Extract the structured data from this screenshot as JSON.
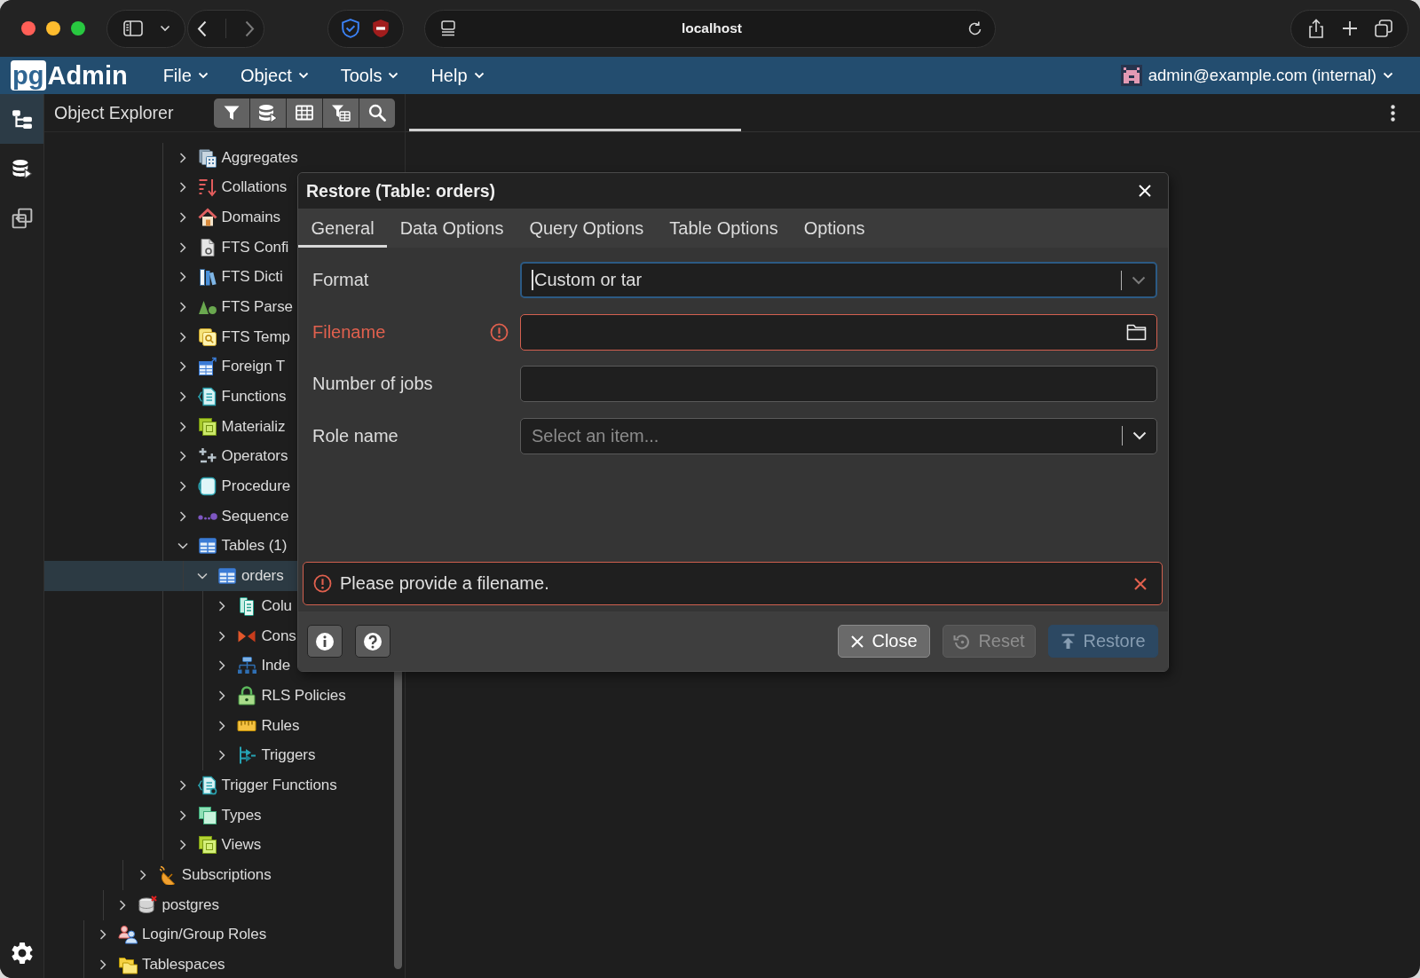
{
  "browser": {
    "address": "localhost"
  },
  "app_header": {
    "logo": {
      "mark": "pg",
      "name": "Admin"
    },
    "menus": [
      {
        "label": "File"
      },
      {
        "label": "Object"
      },
      {
        "label": "Tools"
      },
      {
        "label": "Help"
      }
    ],
    "user": "admin@example.com (internal)"
  },
  "activity_bar": {
    "items": [
      {
        "kind": "explorer",
        "selected": true
      },
      {
        "kind": "databases",
        "selected": false
      },
      {
        "kind": "workspace",
        "selected": false
      }
    ]
  },
  "object_explorer": {
    "title": "Object Explorer",
    "tree": [
      {
        "children": [
          {
            "children": [
              {
                "children": [
                  {
                    "children": [
                      {
                        "label": "Aggregates",
                        "kind": "aggregate",
                        "expanded": false,
                        "selected": false
                      },
                      {
                        "label": "Collations",
                        "kind": "collation",
                        "expanded": false,
                        "selected": false
                      },
                      {
                        "label": "Domains",
                        "kind": "domain",
                        "expanded": false,
                        "selected": false
                      },
                      {
                        "label": "FTS Confi",
                        "kind": "ftsconfig",
                        "expanded": false,
                        "selected": false
                      },
                      {
                        "label": "FTS Dicti",
                        "kind": "ftsdict",
                        "expanded": false,
                        "selected": false
                      },
                      {
                        "label": "FTS Parse",
                        "kind": "ftsparser",
                        "expanded": false,
                        "selected": false
                      },
                      {
                        "label": "FTS Temp",
                        "kind": "ftstemplate",
                        "expanded": false,
                        "selected": false
                      },
                      {
                        "label": "Foreign T",
                        "kind": "foreigntable",
                        "expanded": false,
                        "selected": false
                      },
                      {
                        "label": "Functions",
                        "kind": "function",
                        "expanded": false,
                        "selected": false
                      },
                      {
                        "label": "Materializ",
                        "kind": "matview",
                        "expanded": false,
                        "selected": false
                      },
                      {
                        "label": "Operators",
                        "kind": "operator",
                        "expanded": false,
                        "selected": false
                      },
                      {
                        "label": "Procedure",
                        "kind": "procedure",
                        "expanded": false,
                        "selected": false
                      },
                      {
                        "label": "Sequence",
                        "kind": "sequence",
                        "expanded": false,
                        "selected": false
                      },
                      {
                        "label": "Tables (1)",
                        "kind": "table",
                        "expanded": true,
                        "selected": false,
                        "children": [
                          {
                            "label": "orders",
                            "kind": "table",
                            "expanded": true,
                            "selected": true,
                            "children": [
                              {
                                "label": "Colu",
                                "kind": "column",
                                "expanded": false,
                                "selected": false
                              },
                              {
                                "label": "Cons",
                                "kind": "constraint",
                                "expanded": false,
                                "selected": false
                              },
                              {
                                "label": "Inde",
                                "kind": "index",
                                "expanded": false,
                                "selected": false
                              },
                              {
                                "label": "RLS Policies",
                                "kind": "policy",
                                "expanded": false,
                                "selected": false
                              },
                              {
                                "label": "Rules",
                                "kind": "rule",
                                "expanded": false,
                                "selected": false
                              },
                              {
                                "label": "Triggers",
                                "kind": "trigger",
                                "expanded": false,
                                "selected": false
                              }
                            ]
                          }
                        ]
                      },
                      {
                        "label": "Trigger Functions",
                        "kind": "triggerfunction",
                        "expanded": false,
                        "selected": false
                      },
                      {
                        "label": "Types",
                        "kind": "type",
                        "expanded": false,
                        "selected": false
                      },
                      {
                        "label": "Views",
                        "kind": "view",
                        "expanded": false,
                        "selected": false
                      }
                    ]
                  }
                ]
              },
              {
                "label": "Subscriptions",
                "kind": "subscription",
                "expanded": false,
                "selected": false
              }
            ]
          },
          {
            "label": "postgres",
            "kind": "database",
            "expanded": false,
            "selected": false
          }
        ]
      },
      {
        "label": "Login/Group Roles",
        "kind": "role",
        "expanded": false,
        "selected": false
      },
      {
        "label": "Tablespaces",
        "kind": "tablespace",
        "expanded": false,
        "selected": false
      }
    ]
  },
  "dialog": {
    "title": "Restore (Table: orders)",
    "tabs": [
      {
        "label": "General",
        "selected": true
      },
      {
        "label": "Data Options",
        "selected": false
      },
      {
        "label": "Query Options",
        "selected": false
      },
      {
        "label": "Table Options",
        "selected": false
      },
      {
        "label": "Options",
        "selected": false
      }
    ],
    "fields": [
      {
        "kind": "select",
        "label": "Format",
        "value": "Custom or tar",
        "focused": true,
        "invalid": false
      },
      {
        "kind": "file",
        "label": "Filename",
        "focused": false,
        "invalid": true
      },
      {
        "kind": "text",
        "label": "Number of jobs",
        "focused": false,
        "invalid": false
      },
      {
        "kind": "select",
        "label": "Role name",
        "placeholder": "Select an item...",
        "focused": false,
        "invalid": false
      }
    ],
    "alert": {
      "message": "Please provide a filename."
    },
    "buttons": [
      {
        "kind": "close",
        "label": "Close",
        "disabled": false
      },
      {
        "kind": "reset",
        "label": "Reset",
        "disabled": true
      },
      {
        "kind": "restore",
        "label": "Restore",
        "disabled": true
      }
    ]
  }
}
